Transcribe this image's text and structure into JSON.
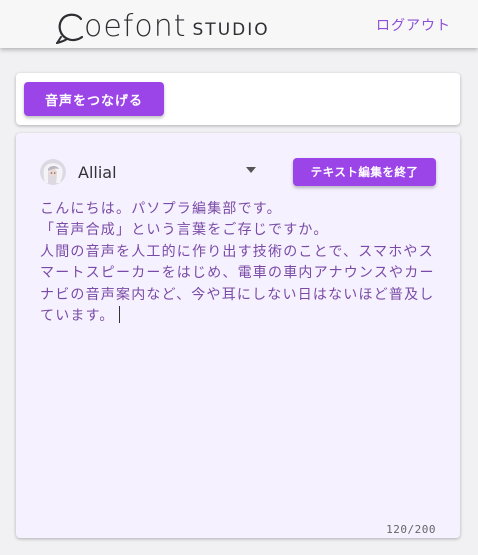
{
  "header": {
    "logo_main": "oefont",
    "logo_sub": "STUDIO",
    "logout_label": "ログアウト"
  },
  "toolbar": {
    "connect_label": "音声をつなげる"
  },
  "editor": {
    "voice_name": "Allial",
    "finish_label": "テキスト編集を終了",
    "lines": [
      "こんにちは。パソプラ編集部です。",
      "「音声合成」という言葉をご存じですか。",
      "人間の音声を人工的に作り出す技術のことで、スマホやス",
      "マートスピーカーをはじめ、電車の車内アナウンスやカー",
      "ナビの音声案内など、今や耳にしない日はないほど普及し",
      "ています。"
    ],
    "char_count": "120/200"
  },
  "colors": {
    "accent": "#9b45e8",
    "text_purple": "#7a4ba6",
    "editor_bg": "#f5f1ff"
  },
  "icons": {
    "logo": "speech-bubble-logo-icon",
    "avatar": "voice-avatar",
    "dropdown": "caret-down-icon"
  }
}
